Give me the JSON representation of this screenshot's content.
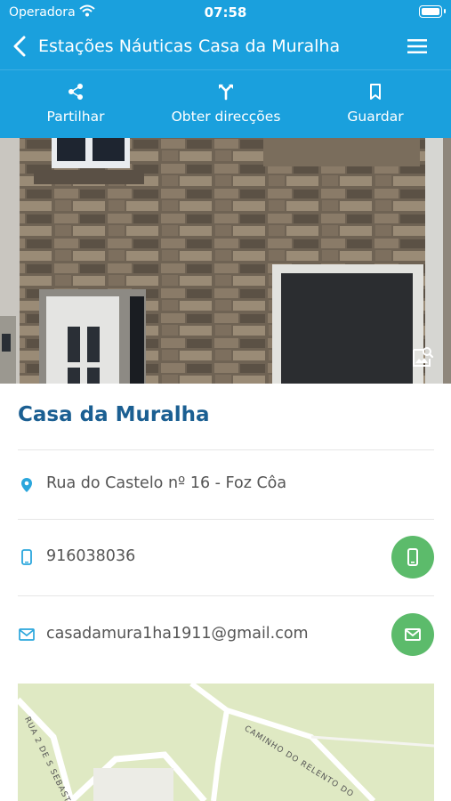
{
  "status_bar": {
    "carrier": "Operadora",
    "time": "07:58"
  },
  "nav": {
    "back_label": "Estações Náuticas",
    "title": "Casa da Muralha"
  },
  "actions": [
    {
      "label": "Partilhar",
      "icon": "share-icon"
    },
    {
      "label": "Obter direcções",
      "icon": "directions-icon"
    },
    {
      "label": "Guardar",
      "icon": "bookmark-icon"
    }
  ],
  "place": {
    "name": "Casa da Muralha",
    "address": "Rua do Castelo nº 16 - Foz Côa",
    "phone": "916038036",
    "email": "casadamura1ha1911@gmail.com"
  },
  "map": {
    "streets": [
      "RUA 2 DE S SEBAST",
      "CAMINHO DO RELENTO DO"
    ]
  },
  "colors": {
    "header": "#1aa0dd",
    "title_text": "#1b5f92",
    "fab_green": "#5cbb6b",
    "row_icon": "#2aa6dc"
  }
}
